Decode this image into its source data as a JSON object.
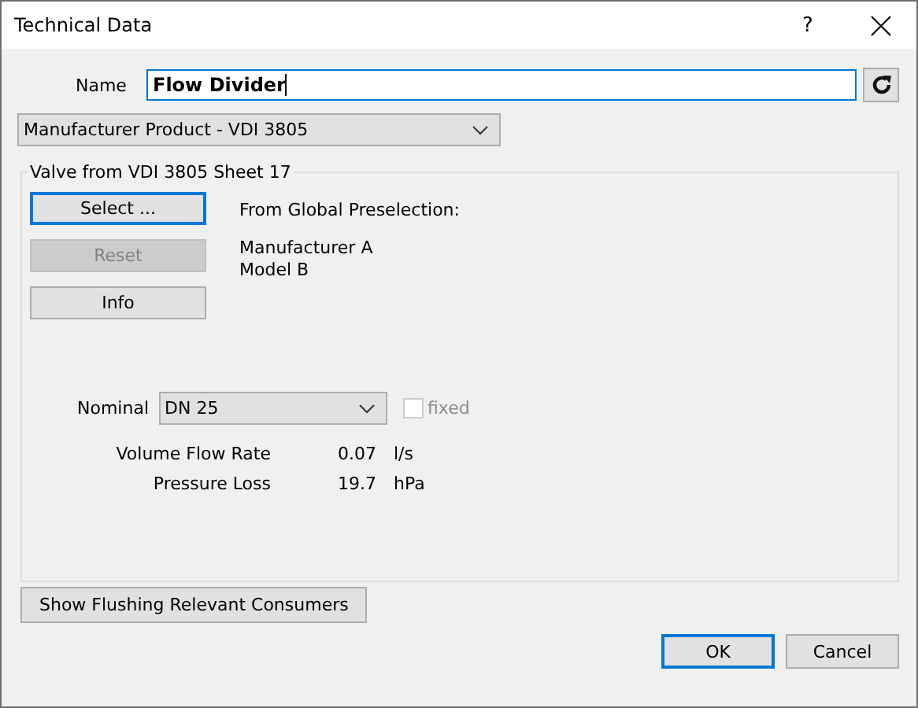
{
  "window": {
    "title": "Technical Data",
    "help": "?"
  },
  "name_field": {
    "label": "Name",
    "value": "Flow Divider",
    "focused": true
  },
  "source_dropdown": {
    "value": "Manufacturer Product - VDI 3805"
  },
  "group": {
    "title": "Valve from VDI 3805 Sheet 17",
    "buttons": [
      {
        "label": "Select ...",
        "disabled": false,
        "focused": true
      },
      {
        "label": "Reset",
        "disabled": true,
        "focused": false
      },
      {
        "label": "Info",
        "disabled": false,
        "focused": false
      }
    ],
    "preselection": {
      "heading": "From Global Preselection:",
      "lines": [
        "Manufacturer A",
        "Model B"
      ]
    },
    "nominal": {
      "label": "Nominal",
      "value": "DN 25",
      "fixed": {
        "label": "fixed",
        "checked": false,
        "disabled": true
      }
    },
    "readings": [
      {
        "label": "Volume Flow Rate",
        "value": "0.07",
        "unit": "l/s"
      },
      {
        "label": "Pressure Loss",
        "value": "19.7",
        "unit": "hPa"
      }
    ]
  },
  "flushing_button": {
    "label": "Show Flushing Relevant Consumers"
  },
  "buttons": [
    {
      "label": "OK",
      "focused": true
    },
    {
      "label": "Cancel",
      "focused": false
    }
  ]
}
